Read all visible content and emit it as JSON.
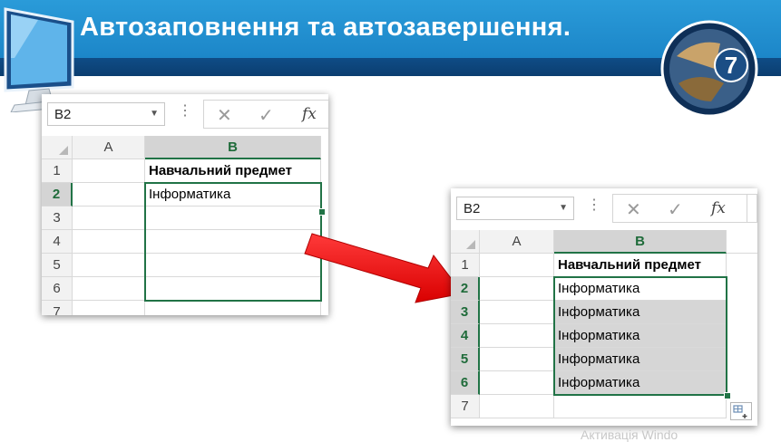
{
  "slide": {
    "title": "Автозаповнення та автозавершення.",
    "badge_number": "7",
    "watermark": "Активація Windo"
  },
  "colors": {
    "header_blue": "#1c86c8",
    "header_dark": "#0b3e70",
    "excel_green": "#217346",
    "arrow_red": "#ff1a1a"
  },
  "sheet_before": {
    "name_box": "B2",
    "columns": [
      "A",
      "B"
    ],
    "rows": [
      "1",
      "2",
      "3",
      "4",
      "5",
      "6",
      "7"
    ],
    "cells": {
      "B1": "Навчальний предмет",
      "B2": "Інформатика"
    }
  },
  "sheet_after": {
    "name_box": "B2",
    "columns": [
      "A",
      "B"
    ],
    "rows": [
      "1",
      "2",
      "3",
      "4",
      "5",
      "6",
      "7"
    ],
    "cells": {
      "B1": "Навчальний предмет",
      "B2": "Інформатика",
      "B3": "Інформатика",
      "B4": "Інформатика",
      "B5": "Інформатика",
      "B6": "Інформатика"
    }
  },
  "icons": {
    "monitor": "monitor-icon",
    "cancel": "close-icon",
    "confirm": "check-icon",
    "function": "fx-icon",
    "dropdown": "chevron-down-icon",
    "autofill": "autofill-options-icon",
    "transition": "red-arrow-icon"
  },
  "formula_bar": {
    "fx_label": "fx",
    "cancel_glyph": "✕",
    "confirm_glyph": "✓",
    "dots": "⋮"
  }
}
